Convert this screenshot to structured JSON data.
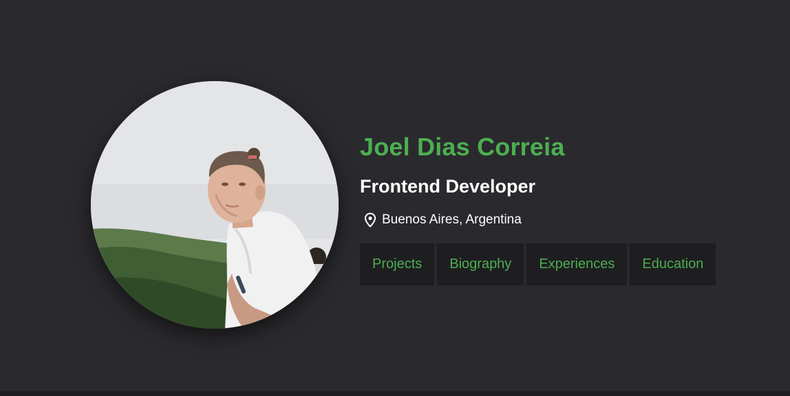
{
  "profile": {
    "name": "Joel Dias Correia",
    "title": "Frontend Developer",
    "location": "Buenos Aires, Argentina",
    "photo_icon": "profile-photo",
    "location_icon": "map-pin-icon"
  },
  "nav": {
    "items": [
      {
        "label": "Projects"
      },
      {
        "label": "Biography"
      },
      {
        "label": "Experiences"
      },
      {
        "label": "Education"
      }
    ]
  },
  "colors": {
    "background": "#2a2a2e",
    "accent": "#4caf50",
    "button_bg": "#1e1e21",
    "text": "#ffffff"
  }
}
